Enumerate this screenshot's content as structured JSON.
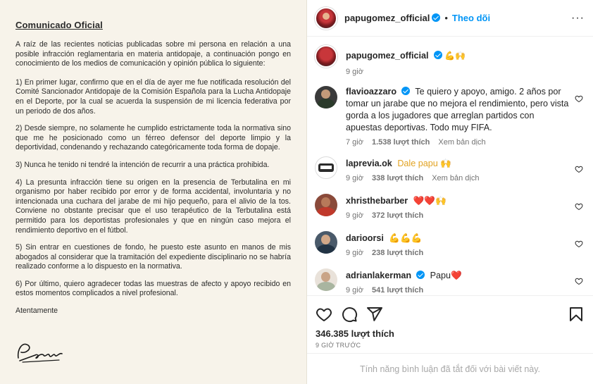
{
  "document": {
    "title": "Comunicado Oficial",
    "intro": "A raíz de las recientes noticias publicadas sobre mi persona en relación a una posible infracción reglamentaria en materia antidopaje, a continuación pongo en conocimiento de los medios de comunicación y opinión pública lo siguiente:",
    "points": [
      "1) En primer lugar, confirmo que en el día de ayer me fue notificada resolución del Comité Sancionador Antidopaje de la Comisión Española para la Lucha Antidopaje en el Deporte, por la cual se acuerda la suspensión de mi licencia federativa por un periodo de dos años.",
      "2) Desde siempre, no solamente he cumplido estrictamente toda la normativa sino que me he posicionado como un férreo defensor del deporte limpio y la deportividad, condenando y rechazando categóricamente toda forma de dopaje.",
      "3) Nunca he tenido ni tendré la intención de recurrir a una práctica prohibida.",
      "4) La presunta infracción tiene su origen en la presencia de Terbutalina en mi organismo por haber recibido por error y de forma accidental, involuntaria y no intencionada una cuchara del jarabe de mi hijo pequeño, para el alivio de la tos. Conviene no obstante precisar que el uso terapéutico de la Terbutalina está permitido para los deportistas profesionales y que en ningún caso mejora el rendimiento deportivo en el fútbol.",
      "5) Sin entrar en cuestiones de fondo, he puesto este asunto en manos de mis abogados al considerar que la tramitación del expediente disciplinario no se habría realizado conforme a lo dispuesto en la normativa.",
      "6) Por último, quiero agradecer todas las muestras de afecto y apoyo recibido en estos momentos complicados a nivel profesional."
    ],
    "closing": "Atentamente",
    "signature": "Papu"
  },
  "header": {
    "username": "papugomez_official",
    "separator": "•",
    "follow_label": "Theo dõi",
    "more_label": "···"
  },
  "caption": {
    "username": "papugomez_official",
    "text": "💪🙌",
    "time": "9 giờ"
  },
  "comments": [
    {
      "username": "flavioazzaro",
      "verified": true,
      "text": "Te quiero y apoyo, amigo. 2 años por tomar un jarabe que no mejora el rendimiento, pero vista gorda a los jugadores que arreglan partidos con apuestas deportivas. Todo muy FIFA.",
      "time": "7 giờ",
      "likes": "1.538 lượt thích",
      "translate": "Xem bản dịch",
      "avatar_color": "#3a3a3a"
    },
    {
      "username": "laprevia.ok",
      "verified": false,
      "text": "Dale papu 🙌",
      "time": "9 giờ",
      "likes": "338 lượt thích",
      "translate": "Xem bản dịch",
      "avatar_color": "#555555"
    },
    {
      "username": "xhristhebarber",
      "verified": false,
      "text": "❤️❤️🙌",
      "time": "9 giờ",
      "likes": "372 lượt thích",
      "translate": "",
      "avatar_color": "#8a4a3a"
    },
    {
      "username": "darioorsi",
      "verified": false,
      "text": "💪💪💪",
      "time": "9 giờ",
      "likes": "238 lượt thích",
      "translate": "",
      "avatar_color": "#4a5a6a"
    },
    {
      "username": "adrianlakerman",
      "verified": true,
      "text": "Papu❤️",
      "time": "9 giờ",
      "likes": "541 lượt thích",
      "translate": "",
      "avatar_color": "#c9b7a5"
    }
  ],
  "actions": {
    "likes_count": "346.385 lượt thích",
    "time_ago": "9 giờ trước",
    "comments_disabled": "Tính năng bình luận đã tắt đối với bài viết này."
  },
  "icons": {
    "like": "heart-icon",
    "comment": "comment-icon",
    "share": "share-icon",
    "save": "bookmark-icon",
    "verified": "verified-badge-icon"
  },
  "colors": {
    "accent": "#0095f6",
    "meta_text": "#737373",
    "paper": "#f7f3ea"
  }
}
